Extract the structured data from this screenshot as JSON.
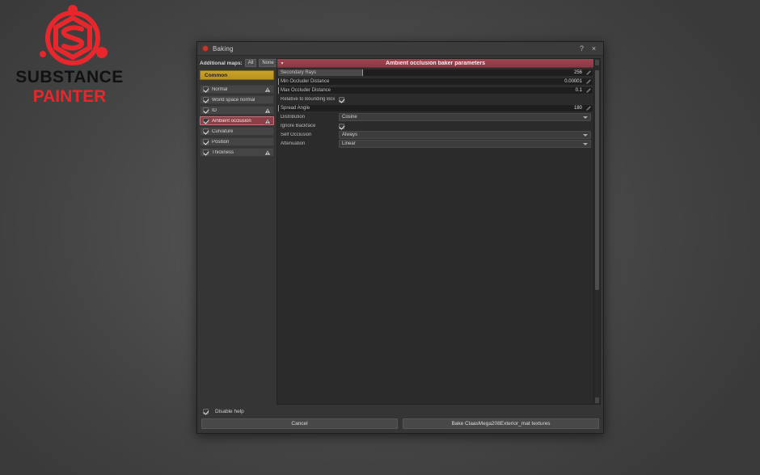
{
  "logo": {
    "line1": "SUBSTANCE",
    "line2": "PAINTER",
    "mark_icon": "substance-s-hexagon-icon",
    "accent_color": "#e8272c",
    "text_color": "#111111"
  },
  "dialog": {
    "title": "Baking",
    "title_icon": "baking-red-dot-icon",
    "help_button": "?",
    "close_button": "×"
  },
  "sidebar": {
    "additional_maps_label": "Additional maps:",
    "all_button": "All",
    "none_button": "None",
    "common_tab": "Common",
    "items": [
      {
        "label": "Normal",
        "checked": true,
        "warning": true,
        "active": false
      },
      {
        "label": "World space normal",
        "checked": true,
        "warning": false,
        "active": false
      },
      {
        "label": "ID",
        "checked": true,
        "warning": true,
        "active": false
      },
      {
        "label": "Ambient occlusion",
        "checked": true,
        "warning": true,
        "active": true
      },
      {
        "label": "Curvature",
        "checked": true,
        "warning": false,
        "active": false
      },
      {
        "label": "Position",
        "checked": true,
        "warning": false,
        "active": false
      },
      {
        "label": "Thickness",
        "checked": true,
        "warning": true,
        "active": false
      }
    ]
  },
  "params": {
    "header_title": "Ambient occlusion baker parameters",
    "collapse_icon": "chevron-down-icon",
    "rows": [
      {
        "type": "slider",
        "label": "Secondary Rays",
        "value": "256",
        "fill_pct": 27
      },
      {
        "type": "slider",
        "label": "Min Occluder Distance",
        "value": "0.00001",
        "fill_pct": 0
      },
      {
        "type": "slider",
        "label": "Max Occluder Distance",
        "value": "0.1",
        "fill_pct": 0
      },
      {
        "type": "checkbox",
        "label": "Relative to Bounding Box",
        "checked": true
      },
      {
        "type": "slider",
        "label": "Spread Angle",
        "value": "180",
        "fill_pct": 0
      },
      {
        "type": "dropdown",
        "label": "Distribution",
        "value": "Cosine"
      },
      {
        "type": "checkbox",
        "label": "Ignore Backface",
        "checked": true
      },
      {
        "type": "dropdown",
        "label": "Self Occlusion",
        "value": "Always"
      },
      {
        "type": "dropdown",
        "label": "Attenuation",
        "value": "Linear"
      }
    ]
  },
  "footer": {
    "disable_help_label": "Disable help",
    "disable_help_checked": true,
    "cancel_label": "Cancel",
    "bake_label": "Bake ClaasMega208Exterior_mat textures"
  }
}
